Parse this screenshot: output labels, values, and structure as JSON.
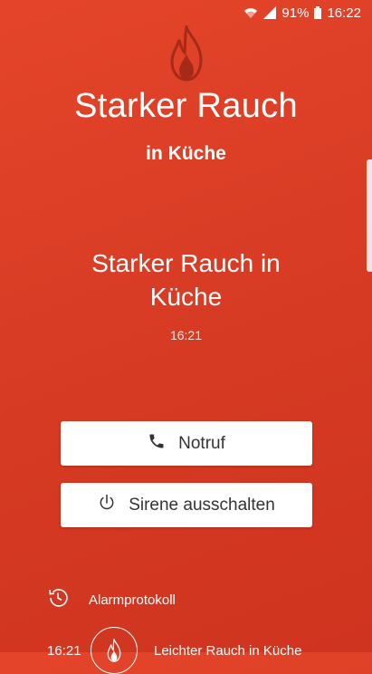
{
  "status_bar": {
    "battery": "91%",
    "time": "16:22"
  },
  "header": {
    "title": "Starker Rauch",
    "subtitle": "in Küche"
  },
  "alert": {
    "message": "Starker Rauch in Küche",
    "time": "16:21"
  },
  "actions": {
    "call_label": "Notruf",
    "siren_label": "Sirene ausschalten"
  },
  "protocol": {
    "label": "Alarmprotokoll",
    "entries": [
      {
        "time": "16:21",
        "text": "Leichter Rauch in Küche",
        "icon": "flame-icon"
      }
    ]
  },
  "colors": {
    "background": "#d63a23",
    "button_bg": "#ffffff",
    "button_text": "#333333",
    "flame": "#b8321c"
  }
}
